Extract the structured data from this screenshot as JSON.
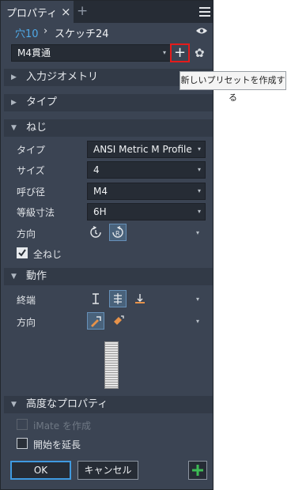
{
  "window": {
    "tab_label": "プロパティ",
    "close_glyph": "×",
    "add_glyph": "+"
  },
  "breadcrumb": {
    "parent": "穴10",
    "separator": "›",
    "current": "スケッチ24"
  },
  "preset": {
    "value": "M4貫通",
    "caret": "▾",
    "add_glyph": "+",
    "settings_glyph": "✿"
  },
  "tooltip": "新しいプリセットを作成する",
  "sections": {
    "input_geometry": "入力ジオメトリ",
    "type": "タイプ",
    "thread": "ねじ",
    "behavior": "動作",
    "advanced": "高度なプロパティ"
  },
  "arrows": {
    "collapsed": "▶",
    "expanded": "▼"
  },
  "thread": {
    "type_label": "タイプ",
    "type_value": "ANSI Metric M Profile",
    "size_label": "サイズ",
    "size_value": "4",
    "designation_label": "呼び径",
    "designation_value": "M4",
    "class_label": "等級寸法",
    "class_value": "6H",
    "direction_label": "方向",
    "full_thread_label": "全ねじ"
  },
  "behavior": {
    "termination_label": "終端",
    "direction_label": "方向"
  },
  "advanced": {
    "imate_label": "iMate を作成",
    "extend_start_label": "開始を延長"
  },
  "footer": {
    "ok": "OK",
    "cancel": "キャンセル"
  },
  "icons": {
    "tab_close": "close-icon",
    "hamburger": "menu-icon",
    "eye": "eye-icon",
    "gear": "gear-icon",
    "plus": "plus-icon",
    "left_hand": "left-hand-thread-icon",
    "right_hand": "right-hand-thread-icon",
    "distance": "distance-termination-icon",
    "through": "through-all-icon",
    "to": "to-termination-icon",
    "dir_default": "default-direction-icon",
    "dir_flip": "flip-direction-icon",
    "green_plus": "add-icon"
  },
  "colors": {
    "accent_link": "#4fa9e6",
    "highlight_box": "#e41b1b",
    "green": "#3dbb55",
    "orange": "#e6924a"
  }
}
